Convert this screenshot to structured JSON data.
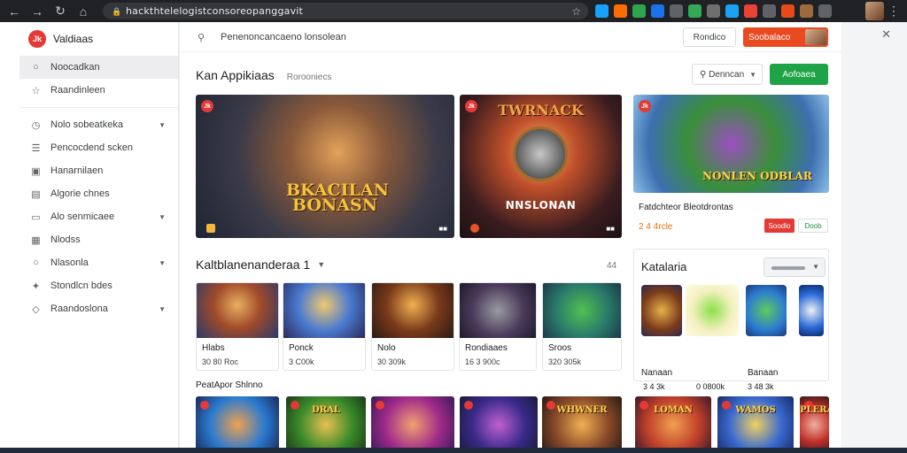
{
  "browser": {
    "url": "hackthtelelogistconsoreopanggavit",
    "extension_colors": [
      "#18a0fb",
      "#ff6d00",
      "#2ea44f",
      "#1a73e8",
      "#5f6368",
      "#34a853",
      "#6e6e6e",
      "#1da1f2",
      "#ea4335",
      "#5f6368",
      "#e64a19",
      "#9e6a3b",
      "#5f6368"
    ]
  },
  "sidebar": {
    "brand": "Valdiaas",
    "items": [
      {
        "label": "Noocadkan",
        "icon": "circle-icon",
        "active": true,
        "chevron": false
      },
      {
        "label": "Raandinleen",
        "icon": "star-icon",
        "active": false,
        "chevron": false
      },
      {
        "label": "Nolo sobeatkeka",
        "icon": "clock-icon",
        "active": false,
        "chevron": true
      },
      {
        "label": "Pencocdend scken",
        "icon": "list-icon",
        "active": false,
        "chevron": false
      },
      {
        "label": "Hanarnilaen",
        "icon": "gamepad-icon",
        "active": false,
        "chevron": false
      },
      {
        "label": "Algorie chnes",
        "icon": "document-icon",
        "active": false,
        "chevron": false
      },
      {
        "label": "Alo senmicaee",
        "icon": "folder-icon",
        "active": false,
        "chevron": true
      },
      {
        "label": "Nlodss",
        "icon": "grid-icon",
        "active": false,
        "chevron": false
      },
      {
        "label": "Nlasonla",
        "icon": "circle-icon",
        "active": false,
        "chevron": true
      },
      {
        "label": "Stondlcn bdes",
        "icon": "puzzle-icon",
        "active": false,
        "chevron": false
      },
      {
        "label": "Raandoslona",
        "icon": "tag-icon",
        "active": false,
        "chevron": true
      }
    ]
  },
  "topbar": {
    "search_text": "Penenoncancaeno lonsolean",
    "outline_button": "Rondico",
    "red_button": "Soobalaco"
  },
  "section": {
    "title": "Kan Appikiaas",
    "subtitle": "Rorooniecs",
    "dropdown": "Denncan",
    "green_button": "Aofoaea"
  },
  "heroes": [
    {
      "caption": "BKACILAN BONASN",
      "badge": "Jk"
    },
    {
      "top_caption": "TWRNACK",
      "bottom_caption": "NNSLONAN",
      "badge": "Jk"
    },
    {
      "caption": "NONLEN ODBLAR",
      "badge": "Jk",
      "title": "Fatdchteor Bleotdrontas",
      "price": "2 4 4rcle",
      "chip_red": "Soodlo",
      "chip_outline": "Doob"
    }
  ],
  "row2": {
    "title": "Kaltblanenanderaa 1",
    "more": "44",
    "cards": [
      {
        "name": "Hlabs",
        "meta": "30 80 Roc"
      },
      {
        "name": "Ponck",
        "meta": "3 C00k"
      },
      {
        "name": "Nolo",
        "meta": "30 309k"
      },
      {
        "name": "Rondiaaes",
        "meta": "16 3 900c"
      },
      {
        "name": "Sroos",
        "meta": "320 305k"
      }
    ]
  },
  "panel": {
    "title": "Katalaria",
    "items": [
      {
        "name": "Nanaan",
        "meta": "3 4 3k"
      },
      {
        "name": "",
        "meta": "0 0800k"
      },
      {
        "name": "Banaan",
        "meta": "3 48 3k"
      }
    ]
  },
  "row3": {
    "title": "PeatApor Shlnno",
    "tiles": [
      "",
      "DRAL",
      "",
      "",
      "WHWNER",
      "LOMAN",
      "WAMOS",
      "PLERA"
    ]
  }
}
